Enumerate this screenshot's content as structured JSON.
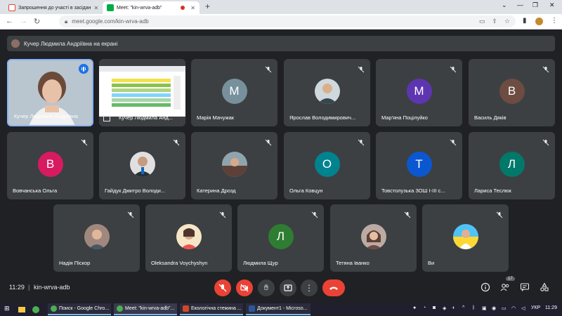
{
  "browser": {
    "tabs": [
      {
        "label": "Запрошення до участі в засідан",
        "icon": "gmail-icon"
      },
      {
        "label": "Meet: \"kin-wrva-adb\"",
        "icon": "meet-icon"
      }
    ],
    "url": "meet.google.com/kin-wrva-adb"
  },
  "meet": {
    "presenter_banner": "Кучер Людмила Андріївна на екрані",
    "tiles": [
      {
        "name": "Кучер Людмила Андріївна",
        "kind": "video"
      },
      {
        "name": "Кучер Людмила Анд...",
        "kind": "screen"
      },
      {
        "name": "Марія Мачужак",
        "initial": "M",
        "color": "#78909c"
      },
      {
        "name": "Ярослав Володимирович...",
        "kind": "photo"
      },
      {
        "name": "Мар'яна Поцілуйко",
        "initial": "M",
        "color": "#5e35b1"
      },
      {
        "name": "Василь Дяків",
        "initial": "B",
        "color": "#6d4c41"
      },
      {
        "name": "Вовчанська Ольга",
        "initial": "B",
        "color": "#d81b60"
      },
      {
        "name": "Гайдук Дмитро Володи...",
        "kind": "photo"
      },
      {
        "name": "Катерина Дрозд",
        "kind": "photo"
      },
      {
        "name": "Ольга Ковцун",
        "initial": "O",
        "color": "#00838f"
      },
      {
        "name": "Товстолузька ЗОШ І-ІІІ с...",
        "initial": "T",
        "color": "#0b57d0"
      },
      {
        "name": "Лариса Теслюк",
        "initial": "Л",
        "color": "#00796b"
      },
      {
        "name": "Надія Піскор",
        "kind": "photo"
      },
      {
        "name": "Oleksandra Voychyshyn",
        "kind": "photo"
      },
      {
        "name": "Людмила Щур",
        "initial": "Л",
        "color": "#2e7d32"
      },
      {
        "name": "Тетяна Іванко",
        "kind": "photo"
      },
      {
        "name": "Ви",
        "kind": "photo"
      }
    ],
    "time": "11:29",
    "separator": "|",
    "meeting_code": "kin-wrva-adb",
    "participants_count": "17"
  },
  "taskbar": {
    "items": [
      {
        "label": "Поиск - Google Chro..."
      },
      {
        "label": "Meet: \"kin-wrva-adb\"..."
      },
      {
        "label": "Екологічна стежина ..."
      },
      {
        "label": "Документ1 - Microso..."
      }
    ],
    "lang": "УКР",
    "clock": "11:29"
  },
  "colors": {
    "background": "#202124",
    "tile": "#3c4043",
    "accent_red": "#ea4335",
    "active_border": "#8ab4f8"
  }
}
